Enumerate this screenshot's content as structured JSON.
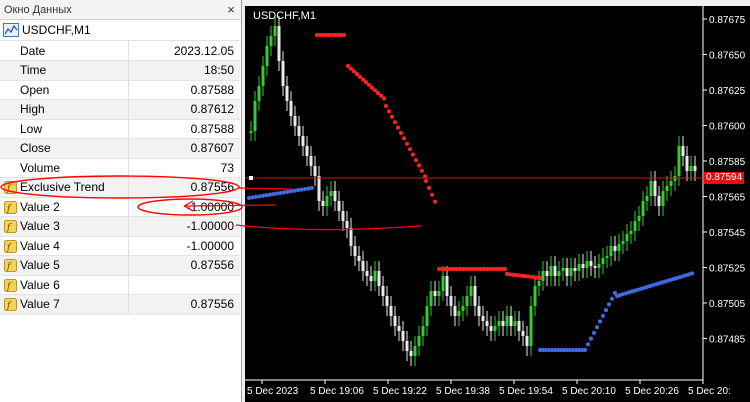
{
  "data_window": {
    "title": "Окно Данных",
    "close_glyph": "×",
    "symbol": "USDCHF,M1",
    "rows": [
      {
        "label": "Date",
        "value": "2023.12.05"
      },
      {
        "label": "Time",
        "value": "18:50"
      },
      {
        "label": "Open",
        "value": "0.87588"
      },
      {
        "label": "High",
        "value": "0.87612"
      },
      {
        "label": "Low",
        "value": "0.87588"
      },
      {
        "label": "Close",
        "value": "0.87607"
      },
      {
        "label": "Volume",
        "value": "73"
      }
    ],
    "indicator_rows": [
      {
        "label": "Exclusive Trend",
        "value": "0.87556"
      },
      {
        "label": "Value 2",
        "value": "-1.00000"
      },
      {
        "label": "Value 3",
        "value": "-1.00000"
      },
      {
        "label": "Value 4",
        "value": "-1.00000"
      },
      {
        "label": "Value 5",
        "value": "0.87556"
      },
      {
        "label": "Value 6",
        "value": ""
      },
      {
        "label": "Value 7",
        "value": "0.87556"
      }
    ],
    "indicator_icon": "function-icon"
  },
  "chart": {
    "label": "USDCHF,M1",
    "price_tag": "0.87594",
    "price_ticks": [
      "0.87675",
      "0.87650",
      "0.87625",
      "0.87600",
      "0.87585",
      "0.87565",
      "0.87545",
      "0.87525",
      "0.87505",
      "0.87485"
    ],
    "time_ticks": [
      "5 Dec 2023",
      "5 Dec 19:06",
      "5 Dec 19:22",
      "5 Dec 19:38",
      "5 Dec 19:54",
      "5 Dec 20:10",
      "5 Dec 20:26",
      "5 Dec 20:"
    ],
    "colors": {
      "background": "#000000",
      "bull": "#32cd32",
      "bear": "#e8e8e8",
      "red_dots": "#ff2020",
      "blue_dots": "#4169e1",
      "annotation": "#ff0000",
      "price_line": "#c81e1e"
    }
  }
}
